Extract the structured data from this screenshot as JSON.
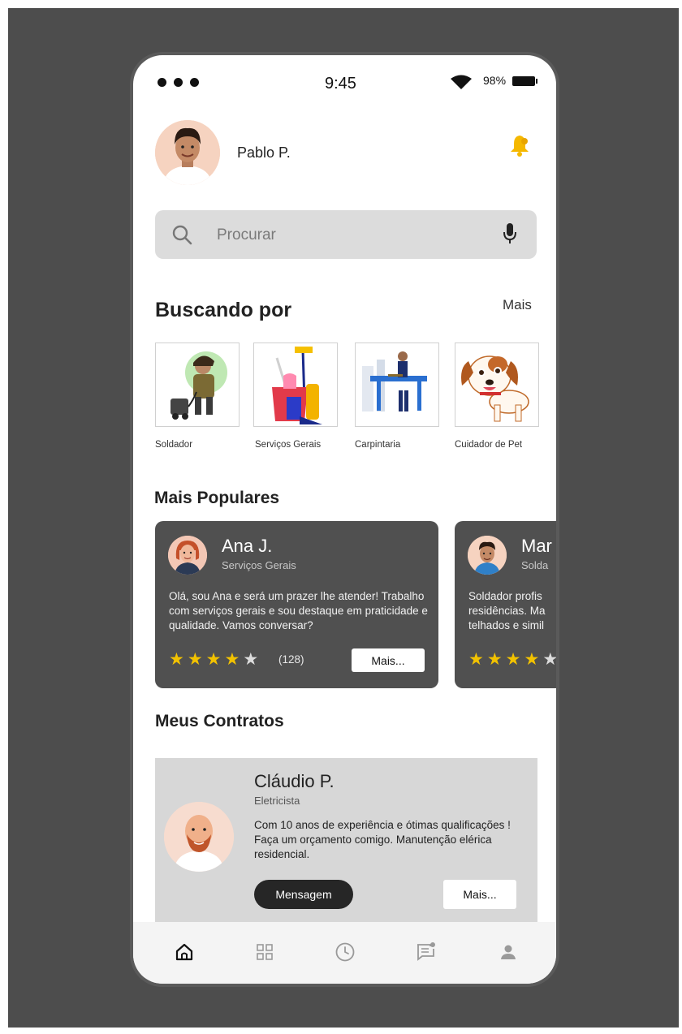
{
  "status_bar": {
    "time": "9:45",
    "battery": "98%"
  },
  "profile": {
    "name": "Pablo P.",
    "avatar_icon": "user-avatar",
    "notification_icon": "bell-icon"
  },
  "search": {
    "placeholder": "Procurar",
    "search_icon": "search-icon",
    "mic_icon": "microphone-icon"
  },
  "searching": {
    "title": "Buscando por",
    "more_label": "Mais",
    "categories": [
      {
        "label": "Soldador"
      },
      {
        "label": "Serviços Gerais"
      },
      {
        "label": "Carpintaria"
      },
      {
        "label": "Cuidador de Pet"
      }
    ]
  },
  "popular": {
    "title": "Mais Populares",
    "cards": [
      {
        "name": "Ana J.",
        "role": "Serviços Gerais",
        "description": "Olá, sou Ana e será um prazer lhe atender! Trabalho com serviços gerais e sou destaque em praticidade e qualidade. Vamos conversar?",
        "rating": 4,
        "reviews": "(128)",
        "more_label": "Mais..."
      },
      {
        "name": "Mar",
        "role": "Solda",
        "description": "Soldador profis residências. Ma telhados e simil",
        "rating": 4
      }
    ]
  },
  "contracts": {
    "title": "Meus Contratos",
    "card": {
      "name": "Cláudio P.",
      "role": "Eletricista",
      "description": "Com 10 anos de experiência e ótimas qualificações ! Faça um orçamento comigo. Manutenção elérica residencial.",
      "message_label": "Mensagem",
      "more_label": "Mais..."
    }
  },
  "bottom_nav": [
    {
      "icon": "home-icon",
      "active": true
    },
    {
      "icon": "grid-icon",
      "active": false
    },
    {
      "icon": "clock-icon",
      "active": false
    },
    {
      "icon": "messages-icon",
      "active": false
    },
    {
      "icon": "profile-icon",
      "active": false
    }
  ],
  "colors": {
    "accent_star": "#f2c200",
    "card_dark": "#505050",
    "contract_bg": "#d7d7d7",
    "backdrop": "#4d4d4d"
  }
}
